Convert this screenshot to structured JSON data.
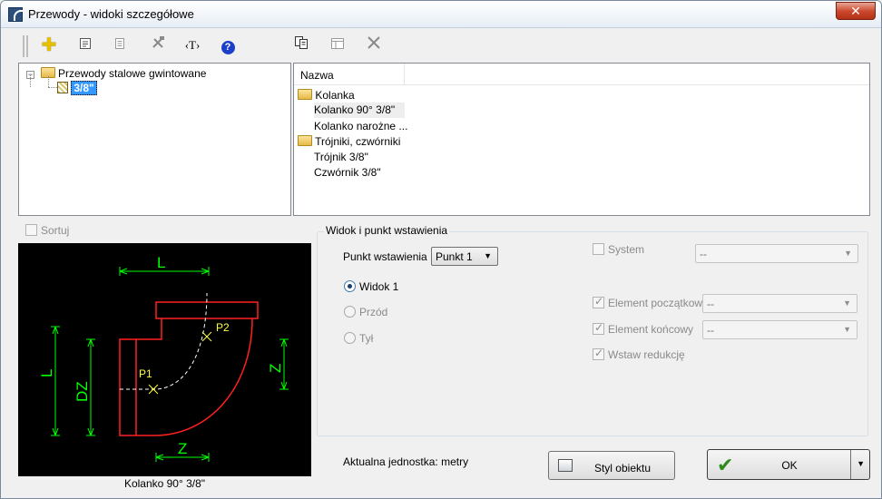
{
  "window": {
    "title": "Przewody - widoki szczegółowe",
    "close_glyph": "✕"
  },
  "toolbar": {
    "icons": [
      "add-icon",
      "document-icon",
      "list-icon",
      "tools-icon",
      "text-tag-icon",
      "help-icon",
      "copy-icon",
      "properties-icon",
      "delete-icon"
    ],
    "text_tag": "‹T›",
    "help_glyph": "?"
  },
  "tree": {
    "root_label": "Przewody stalowe gwintowane",
    "child_label": "3/8\""
  },
  "list": {
    "header": "Nazwa",
    "rows": [
      {
        "label": "Kolanka",
        "type": "folder"
      },
      {
        "label": "Kolanko 90° 3/8\"",
        "type": "item"
      },
      {
        "label": "Kolanko narożne ...",
        "type": "item"
      },
      {
        "label": "Trójniki, czwórniki",
        "type": "folder"
      },
      {
        "label": "Trójnik 3/8\"",
        "type": "item"
      },
      {
        "label": "Czwórnik  3/8\"",
        "type": "item"
      }
    ]
  },
  "sortuj": {
    "label": "Sortuj",
    "checked": false
  },
  "preview": {
    "caption": "Kolanko 90° 3/8\"",
    "dim_labels": [
      "L",
      "L",
      "DZ",
      "Z",
      "Z"
    ],
    "point_labels": [
      "P1",
      "P2"
    ]
  },
  "group": {
    "title": "Widok i punkt wstawienia",
    "insert_point_label": "Punkt wstawienia",
    "insert_point_value": "Punkt 1",
    "views": [
      {
        "label": "Widok 1",
        "selected": true,
        "enabled": true
      },
      {
        "label": "Przód",
        "selected": false,
        "enabled": false
      },
      {
        "label": "Tył",
        "selected": false,
        "enabled": false
      }
    ],
    "system_label": "System",
    "system_value": "--",
    "element_start_label": "Element początkowy",
    "element_start_value": "--",
    "element_end_label": "Element końcowy",
    "element_end_value": "--",
    "reduction_label": "Wstaw redukcję"
  },
  "footer": {
    "unit_text": "Aktualna jednostka: metry",
    "style_button": "Styl obiektu",
    "ok_button": "OK"
  },
  "colors": {
    "drawing_background": "#000000",
    "pipe_outline": "#ff2020",
    "dimension": "#00ff00",
    "points": "#ffff40"
  }
}
